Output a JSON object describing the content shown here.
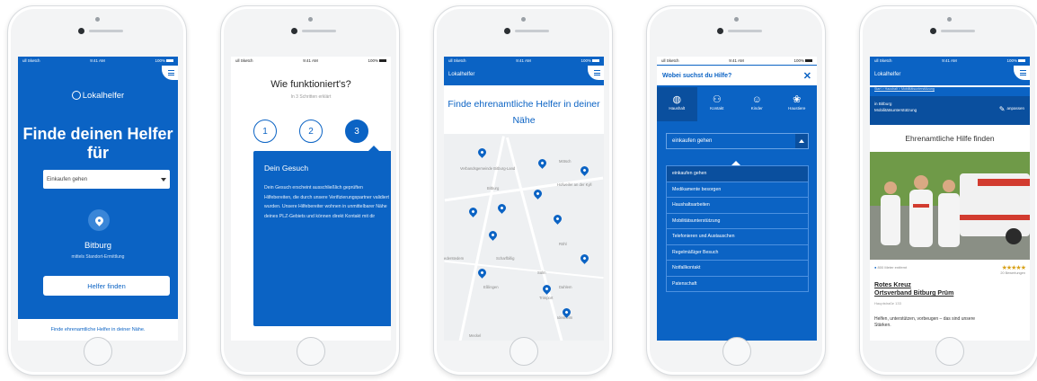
{
  "status": {
    "carrier": "ull Sketch",
    "time": "9:41 AM",
    "battery": "100%"
  },
  "brand": "Lokalhelfer",
  "screen1": {
    "headline": "Finde deinen Helfer für",
    "select_value": "Einkaufen gehen",
    "city": "Bitburg",
    "city_sub": "mittels Standort-Ermittlung",
    "button": "Helfer finden",
    "footer": "Finde ehrenamtliche Helfer in deiner Nähe."
  },
  "screen2": {
    "title": "Wie funktioniert's?",
    "subtitle": "In 3 Schritten erklärt",
    "steps": [
      "1",
      "2",
      "3"
    ],
    "panel_title": "Dein Gesuch",
    "panel_text": "Dein Gesuch erscheint ausschließlich geprüften Hilfebereiten, die durch unsere Verifizierungspartner validiert wurden. Unsere Hilfebereiter wohnen in unmittelbarer Nähe deines PLZ-Gebiets und können direkt Kontakt mit dir"
  },
  "screen3": {
    "title": "Finde ehrenamtliche Helfer in deiner Nähe",
    "map_labels": [
      "Verbandsgemeinde Bitburg-Land",
      "Mötsch",
      "Bitburg",
      "Hofweiler an der Kyll",
      "Scharfbillig",
      "Röhl",
      "Sülm",
      "Dahlem",
      "Idenheim",
      "Trimport",
      "Eßlingen",
      "Meckel",
      "ederstedem"
    ]
  },
  "screen4": {
    "title": "Wobei suchst du Hilfe?",
    "categories": [
      {
        "label": "Haushalt",
        "icon": "globe-icon"
      },
      {
        "label": "Kontakt",
        "icon": "people-icon"
      },
      {
        "label": "Kinder",
        "icon": "smiley-icon"
      },
      {
        "label": "Haustiere",
        "icon": "paw-icon"
      }
    ],
    "selected": "einkaufen gehen",
    "options": [
      "einkaufen gehen",
      "Medikamente besorgen",
      "Haushaltsarbeiten",
      "Mobilitätsunterstützung",
      "Telefonieren und Austauschen",
      "Regelmäßiger Besuch",
      "Notfallkontakt",
      "Patenschaft"
    ]
  },
  "screen5": {
    "breadcrumb": "Start > Haushalt > Mobilitätsunterstützung",
    "location": "in Bitburg",
    "location_sub": "Mobilitätsunterstützung",
    "edit": "anpassen",
    "title": "Ehrenamtliche Hilfe finden",
    "distance": "800 Meter entfernt",
    "rating_count": "20 Bewertungen",
    "org_line1": "Rotes Kreuz",
    "org_line2": "Ortsverband Bitburg Prüm",
    "address": "Hauptstraße 133",
    "description": "Helfen, unterstützen, vorbeugen – das sind unsere Stärken.",
    "stars": "★★★★★"
  },
  "colors": {
    "primary": "#0b63c4",
    "primary_dark": "#0a4f9e",
    "star": "#d8a21a"
  }
}
